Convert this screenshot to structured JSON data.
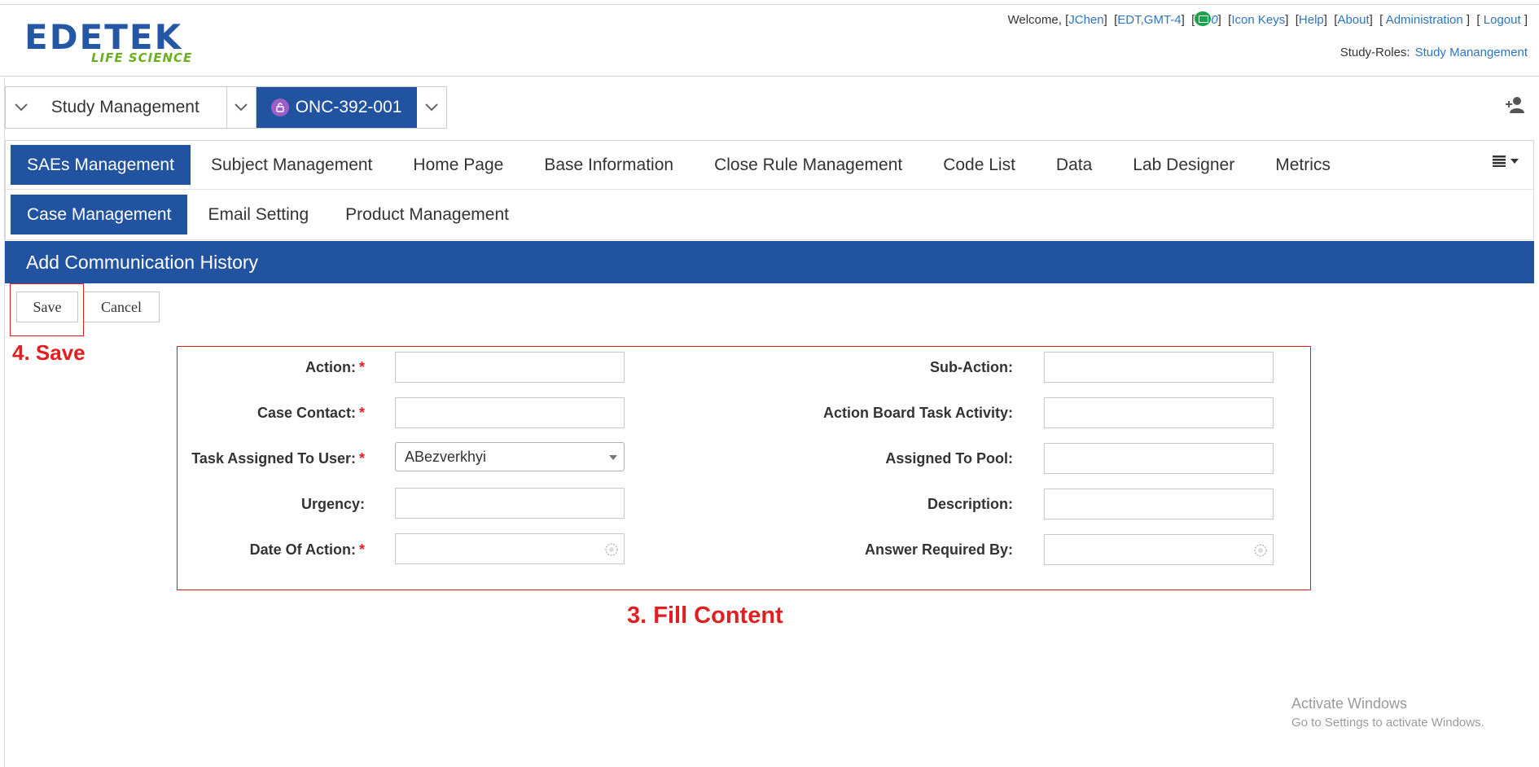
{
  "header": {
    "logo_brand": "EDETEK",
    "logo_sub": "LIFE SCIENCE",
    "welcome_prefix": "Welcome, ",
    "user": "JChen",
    "timezone": "EDT,GMT-4",
    "message_count": "0",
    "icon_keys": "Icon Keys",
    "help": "Help",
    "about": "About",
    "administration": "Administration",
    "logout": "Logout",
    "study_roles_label": "Study-Roles:",
    "study_roles_value": "Study Manangement"
  },
  "selector": {
    "module": "Study Management",
    "protocol": "ONC-392-001"
  },
  "nav": {
    "main": [
      {
        "label": "SAEs Management",
        "active": true
      },
      {
        "label": "Subject Management"
      },
      {
        "label": "Home Page"
      },
      {
        "label": "Base Information"
      },
      {
        "label": "Close Rule Management"
      },
      {
        "label": "Code List"
      },
      {
        "label": "Data"
      },
      {
        "label": "Lab Designer"
      },
      {
        "label": "Metrics"
      }
    ],
    "sub": [
      {
        "label": "Case Management",
        "active": true
      },
      {
        "label": "Email Setting"
      },
      {
        "label": "Product Management"
      }
    ]
  },
  "section": {
    "title": "Add Communication History"
  },
  "buttons": {
    "save": "Save",
    "cancel": "Cancel"
  },
  "annotations": {
    "save": "4. Save",
    "fill": "3. Fill Content"
  },
  "form": {
    "required_mark": "*",
    "action": {
      "label": "Action:",
      "value": ""
    },
    "case_contact": {
      "label": "Case Contact:",
      "value": ""
    },
    "task_assigned": {
      "label": "Task Assigned To User:",
      "value": "ABezverkhyi"
    },
    "urgency": {
      "label": "Urgency:",
      "value": ""
    },
    "date_of_action": {
      "label": "Date Of Action:",
      "value": ""
    },
    "sub_action": {
      "label": "Sub-Action:",
      "value": ""
    },
    "action_board": {
      "label": "Action Board Task Activity:",
      "value": ""
    },
    "assigned_pool": {
      "label": "Assigned To Pool:",
      "value": ""
    },
    "description": {
      "label": "Description:",
      "value": ""
    },
    "answer_required": {
      "label": "Answer Required By:",
      "value": ""
    }
  },
  "watermark": {
    "line1": "Activate Windows",
    "line2": "Go to Settings to activate Windows."
  },
  "colors": {
    "primary": "#2253a0",
    "link": "#2e74c0",
    "annotation": "#e02020",
    "required": "#e02020"
  }
}
